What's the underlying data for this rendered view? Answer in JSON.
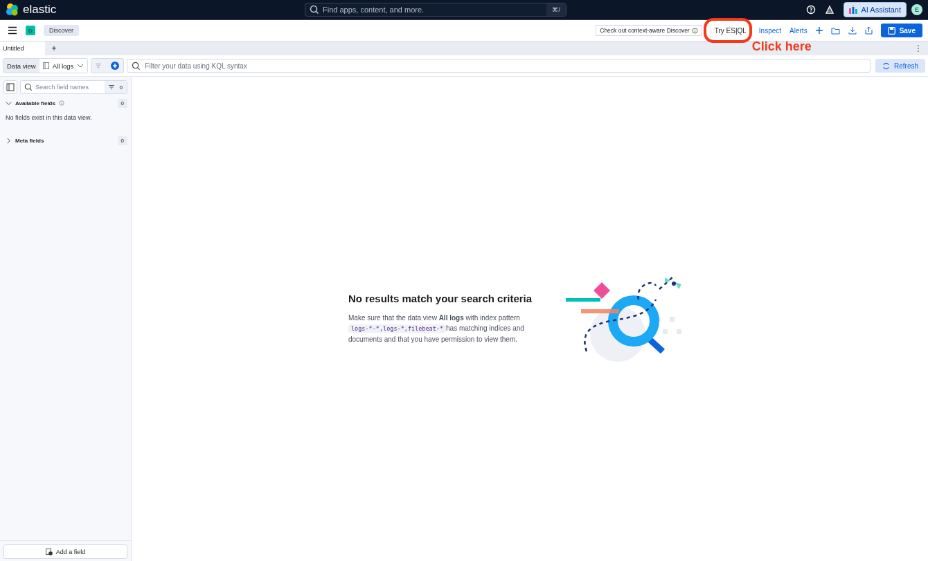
{
  "header": {
    "logo_text": "elastic",
    "search_placeholder": "Find apps, content, and more.",
    "shortcut": "⌘/",
    "ai_button": "AI Assistant",
    "avatar": "E"
  },
  "toolbar": {
    "app_badge": "D",
    "breadcrumb": "Discover",
    "context_button": "Check out context-aware Discover",
    "esql_button": "Try ES|QL",
    "links": [
      "Inspect",
      "Alerts"
    ],
    "save": "Save"
  },
  "tabs": [
    {
      "label": "Untitled",
      "selected": true
    }
  ],
  "add_tab": "+",
  "query": {
    "data_view_label": "Data view",
    "data_view_value": "All logs",
    "placeholder": "Filter your data using KQL syntax",
    "refresh": "Refresh"
  },
  "sidebar": {
    "search_placeholder": "Search field names",
    "filter_count": "0",
    "sections": [
      {
        "title": "Available fields",
        "expanded": true,
        "count": "0",
        "message": "No fields exist in this data view."
      },
      {
        "title": "Meta fields",
        "expanded": false,
        "count": "0"
      }
    ],
    "add_field": "Add a field"
  },
  "empty": {
    "title": "No results match your search criteria",
    "intro": "Make sure that the data view **All logs** with index pattern",
    "pattern": "logs-*-*,logs-*,filebeat-*",
    "outro": [
      "has matching indices and",
      "documents and that you have permission to view them."
    ]
  },
  "annotation": {
    "text": "Click here"
  }
}
